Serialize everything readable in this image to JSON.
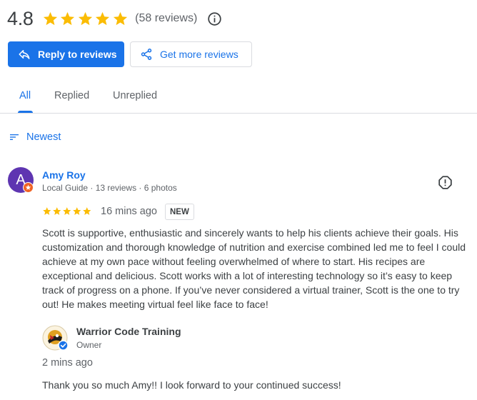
{
  "summary": {
    "rating": "4.8",
    "stars_filled": 5,
    "review_count": "(58 reviews)",
    "star_color": "#fbbc04"
  },
  "actions": {
    "reply_label": "Reply to reviews",
    "get_more_label": "Get more reviews",
    "primary_color": "#1a73e8"
  },
  "tabs": [
    {
      "label": "All",
      "active": true
    },
    {
      "label": "Replied",
      "active": false
    },
    {
      "label": "Unreplied",
      "active": false
    }
  ],
  "sort": {
    "label": "Newest",
    "icon": "sort-icon"
  },
  "review": {
    "avatar_letter": "A",
    "avatar_color": "#5e35b1",
    "badge_color": "#f06325",
    "name": "Amy Roy",
    "meta": "Local Guide · 13 reviews · 6 photos",
    "rating": 5,
    "time": "16 mins ago",
    "badge": "NEW",
    "text": "Scott is supportive, enthusiastic and sincerely wants to help his clients achieve their goals. His customization and thorough knowledge of nutrition and exercise combined led me to feel I could achieve at my own pace without feeling overwhelmed of where to start. His recipes are exceptional and delicious. Scott works with a lot of interesting technology so it’s easy to keep track of progress on a phone. If you’ve never considered a virtual trainer, Scott is the one to try out! He makes meeting virtual feel like face to face!"
  },
  "reply": {
    "owner_name": "Warrior Code Training",
    "owner_role": "Owner",
    "time": "2 mins ago",
    "text": "Thank you so much Amy!! I look forward to your continued success!"
  }
}
